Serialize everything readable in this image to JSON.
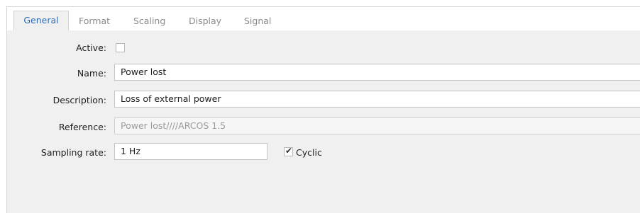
{
  "tabs": {
    "general": "General",
    "format": "Format",
    "scaling": "Scaling",
    "display": "Display",
    "signal": "Signal"
  },
  "form": {
    "active_label": "Active:",
    "active_checked": false,
    "name_label": "Name:",
    "name_value": "Power lost",
    "description_label": "Description:",
    "description_value": "Loss of external power",
    "reference_label": "Reference:",
    "reference_value": "Power lost////ARCOS 1.5",
    "sampling_label": "Sampling rate:",
    "sampling_value": "1 Hz",
    "cyclic_label": "Cyclic",
    "cyclic_checked": true
  },
  "colors": {
    "active_tab_text": "#2b6cb5",
    "panel_background": "#f0f0f0",
    "readonly_text": "#9a9a9a"
  },
  "icons": {
    "cyclic_check": "check-mark-icon"
  }
}
